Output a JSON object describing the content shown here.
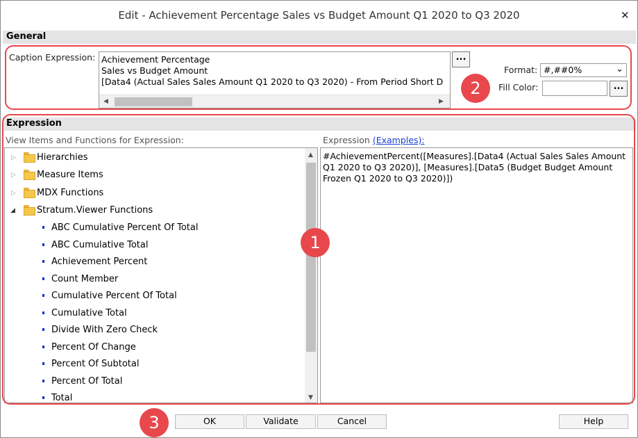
{
  "dialog": {
    "title": "Edit - Achievement Percentage Sales vs Budget Amount Q1 2020 to Q3 2020",
    "close_glyph": "✕"
  },
  "general": {
    "header": "General",
    "caption_label": "Caption Expression:",
    "caption_lines": [
      "Achievement Percentage",
      "Sales vs Budget Amount",
      "[Data4 (Actual Sales Sales Amount Q1 2020 to Q3 2020) - From Period Short D"
    ],
    "ellipsis_label": "...",
    "format_label": "Format:",
    "format_value": "#,##0%",
    "fill_color_label": "Fill Color:",
    "fill_color_value": ""
  },
  "expression": {
    "header": "Expression",
    "left_label": "View Items and Functions for Expression:",
    "right_label": "Expression",
    "examples_link": "(Examples):",
    "text": "#AchievementPercent([Measures].[Data4 (Actual Sales Sales Amount Q1 2020 to Q3 2020)], [Measures].[Data5 (Budget Budget Amount Frozen Q1 2020 to Q3 2020)])",
    "folders": [
      {
        "label": "Hierarchies",
        "expanded": false
      },
      {
        "label": "Measure Items",
        "expanded": false
      },
      {
        "label": "MDX Functions",
        "expanded": false
      },
      {
        "label": "Stratum.Viewer Functions",
        "expanded": true
      }
    ],
    "functions": [
      "ABC Cumulative Percent Of Total",
      "ABC Cumulative Total",
      "Achievement Percent",
      "Count Member",
      "Cumulative Percent Of Total",
      "Cumulative Total",
      "Divide With Zero Check",
      "Percent Of Change",
      "Percent Of Subtotal",
      "Percent Of Total",
      "Total"
    ]
  },
  "buttons": {
    "ok": "OK",
    "validate": "Validate",
    "cancel": "Cancel",
    "help": "Help"
  },
  "callouts": [
    "1",
    "2",
    "3"
  ],
  "colors": {
    "callout_red": "#e8474c",
    "section_header_bg": "#e4e4e4",
    "link_blue": "#1a3fd8",
    "bullet_blue": "#1a2fd0",
    "folder_yellow": "#f5c84c"
  }
}
